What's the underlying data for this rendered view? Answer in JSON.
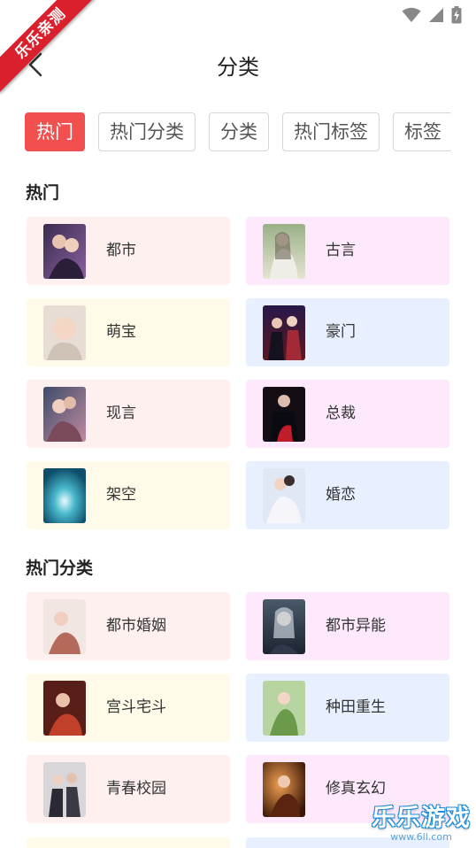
{
  "ribbon": {
    "text": "乐乐亲测"
  },
  "header": {
    "title": "分类"
  },
  "tabs": [
    {
      "label": "热门",
      "active": true
    },
    {
      "label": "热门分类",
      "active": false
    },
    {
      "label": "分类",
      "active": false
    },
    {
      "label": "热门标签",
      "active": false
    },
    {
      "label": "标签",
      "active": false
    }
  ],
  "sections": [
    {
      "title": "热门",
      "items": [
        {
          "label": "都市",
          "bg": "#fff0f0"
        },
        {
          "label": "古言",
          "bg": "#fde9fb"
        },
        {
          "label": "萌宝",
          "bg": "#fffbe8"
        },
        {
          "label": "豪门",
          "bg": "#e8f0ff"
        },
        {
          "label": "现言",
          "bg": "#fff0f0"
        },
        {
          "label": "总裁",
          "bg": "#fde9fb"
        },
        {
          "label": "架空",
          "bg": "#fffbe8"
        },
        {
          "label": "婚恋",
          "bg": "#e8f0ff"
        }
      ]
    },
    {
      "title": "热门分类",
      "items": [
        {
          "label": "都市婚姻",
          "bg": "#fff0f0"
        },
        {
          "label": "都市异能",
          "bg": "#fde9fb"
        },
        {
          "label": "宫斗宅斗",
          "bg": "#fffbe8"
        },
        {
          "label": "种田重生",
          "bg": "#e8f0ff"
        },
        {
          "label": "青春校园",
          "bg": "#fff0f0"
        },
        {
          "label": "修真玄幻",
          "bg": "#fde9fb"
        }
      ]
    }
  ],
  "watermark": {
    "brand": "乐乐游戏",
    "url": "www.6ll.com"
  },
  "colors": {
    "accent": "#f24f4f",
    "ribbon": "#d9202c"
  }
}
